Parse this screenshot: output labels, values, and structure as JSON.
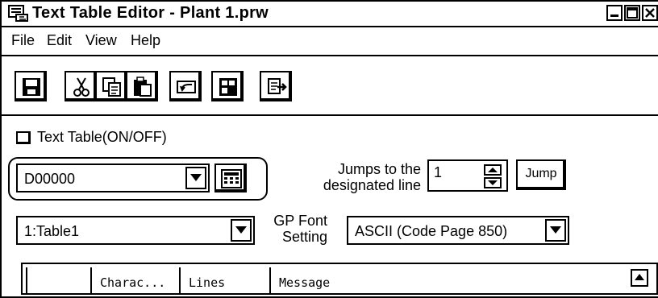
{
  "window": {
    "title": "Text Table Editor - Plant 1.prw"
  },
  "menu": {
    "items": [
      {
        "label": "File"
      },
      {
        "label": "Edit"
      },
      {
        "label": "View"
      },
      {
        "label": "Help"
      }
    ]
  },
  "toolbar": {
    "buttons": [
      {
        "icon": "save-icon"
      },
      {
        "icon": "cut-icon"
      },
      {
        "icon": "copy-icon"
      },
      {
        "icon": "paste-icon"
      },
      {
        "icon": "undo-icon"
      },
      {
        "icon": "table-icon"
      },
      {
        "icon": "export-icon"
      }
    ]
  },
  "text_table_toggle": {
    "label": "Text Table(ON/OFF)",
    "checked": false
  },
  "address": {
    "value": "D00000"
  },
  "jump": {
    "label_line1": "Jumps to the",
    "label_line2": "designated line",
    "value": "1",
    "button_label": "Jump"
  },
  "table_select": {
    "value": "1:Table1"
  },
  "gp_font": {
    "label_line1": "GP Font",
    "label_line2": "Setting",
    "value": "ASCII (Code Page 850)"
  },
  "grid": {
    "columns": [
      "",
      "Charac...",
      "Lines",
      "Message"
    ]
  }
}
